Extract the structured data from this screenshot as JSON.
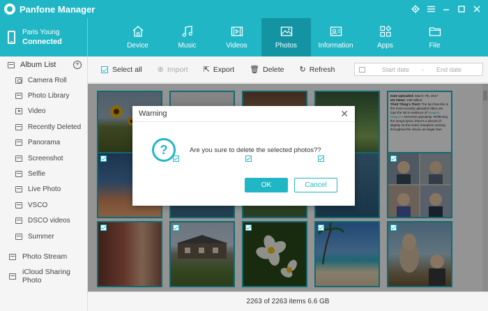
{
  "app": {
    "title": "Panfone Manager"
  },
  "window_controls": [
    "gear-icon",
    "menu-icon",
    "minimize-icon",
    "maximize-icon",
    "close-icon"
  ],
  "device": {
    "name": "Paris Young",
    "status": "Connected"
  },
  "tabs": [
    {
      "label": "Device",
      "icon": "home-icon",
      "active": false
    },
    {
      "label": "Music",
      "icon": "music-icon",
      "active": false
    },
    {
      "label": "Videos",
      "icon": "film-icon",
      "active": false
    },
    {
      "label": "Photos",
      "icon": "image-icon",
      "active": true
    },
    {
      "label": "Information",
      "icon": "contact-card-icon",
      "active": false
    },
    {
      "label": "Apps",
      "icon": "apps-grid-icon",
      "active": false
    },
    {
      "label": "File",
      "icon": "folder-icon",
      "active": false
    }
  ],
  "sidebar": {
    "album_list_label": "Album List",
    "albums": [
      "Camera Roll",
      "Photo Library",
      "Video",
      "Recently Deleted",
      "Panorama",
      "Screenshot",
      "Selfie",
      "Live Photo",
      "VSCO",
      "DSCO videos",
      "Summer"
    ],
    "photo_stream": "Photo Stream",
    "icloud_sharing": "iCloud Sharing Photo"
  },
  "toolbar": {
    "select_all": "Select all",
    "import": "Import",
    "export": "Export",
    "delete": "Delete",
    "refresh": "Refresh",
    "start_date": "Start date",
    "date_separator": "-",
    "end_date": "End date"
  },
  "text_photo": {
    "line1_label": "Date Uploaded:",
    "line1_value": " March 7th, 2017",
    "line2_label": "US Views:",
    "line2_value": " 158 million",
    "line3_label": "Third Thing's Third:",
    "line3_value": " The fact that this is the most recently uploaded video yet tops the list is evidence of ",
    "line3_link": "Imagine Dragon's",
    "line3_tail": " immense popularity. Reflecting the song's lyrics, there's a decent (if slightly on-the-nose) metaphor running throughout the visual, as singer Dan"
  },
  "dialog": {
    "title": "Warning",
    "message": "Are you sure to delete the selected photos??",
    "ok": "OK",
    "cancel": "Cancel"
  },
  "status": {
    "summary": "2263 of 2263 items 6.6 GB"
  },
  "colors": {
    "accent": "#21b6c5",
    "accent_dark": "#1494a3"
  }
}
